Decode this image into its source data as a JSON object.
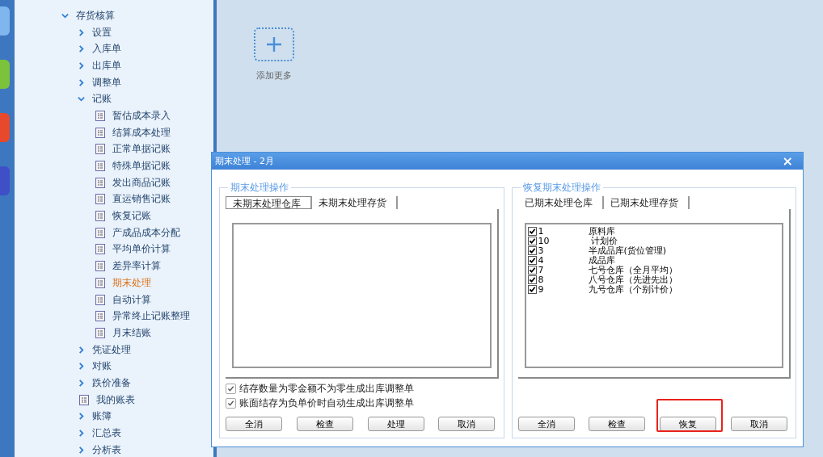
{
  "tree": [
    {
      "label": "存货核算",
      "kind": "folder",
      "expanded": true,
      "selected": false,
      "children": [
        {
          "label": "设置",
          "kind": "folder",
          "expanded": false,
          "selected": false
        },
        {
          "label": "入库单",
          "kind": "folder",
          "expanded": false,
          "selected": false
        },
        {
          "label": "出库单",
          "kind": "folder",
          "expanded": false,
          "selected": false
        },
        {
          "label": "调整单",
          "kind": "folder",
          "expanded": false,
          "selected": false
        },
        {
          "label": "记账",
          "kind": "folder",
          "expanded": true,
          "selected": false,
          "children": [
            {
              "label": "暂估成本录入",
              "kind": "doc",
              "selected": false
            },
            {
              "label": "结算成本处理",
              "kind": "doc",
              "selected": false
            },
            {
              "label": "正常单据记账",
              "kind": "doc",
              "selected": false
            },
            {
              "label": "特殊单据记账",
              "kind": "doc",
              "selected": false
            },
            {
              "label": "发出商品记账",
              "kind": "doc",
              "selected": false
            },
            {
              "label": "直运销售记账",
              "kind": "doc",
              "selected": false
            },
            {
              "label": "恢复记账",
              "kind": "doc",
              "selected": false
            },
            {
              "label": "产成品成本分配",
              "kind": "doc",
              "selected": false
            },
            {
              "label": "平均单价计算",
              "kind": "doc",
              "selected": false
            },
            {
              "label": "差异率计算",
              "kind": "doc",
              "selected": false
            },
            {
              "label": "期末处理",
              "kind": "doc",
              "selected": true
            },
            {
              "label": "自动计算",
              "kind": "doc",
              "selected": false
            },
            {
              "label": "异常终止记账整理",
              "kind": "doc",
              "selected": false
            },
            {
              "label": "月末结账",
              "kind": "doc",
              "selected": false
            }
          ]
        },
        {
          "label": "凭证处理",
          "kind": "folder",
          "expanded": false,
          "selected": false
        },
        {
          "label": "对账",
          "kind": "folder",
          "expanded": false,
          "selected": false
        },
        {
          "label": "跌价准备",
          "kind": "folder",
          "expanded": false,
          "selected": false
        },
        {
          "label": "我的账表",
          "kind": "doc",
          "selected": false
        },
        {
          "label": "账簿",
          "kind": "folder",
          "expanded": false,
          "selected": false
        },
        {
          "label": "汇总表",
          "kind": "folder",
          "expanded": false,
          "selected": false
        },
        {
          "label": "分析表",
          "kind": "folder",
          "expanded": false,
          "selected": false
        }
      ]
    }
  ],
  "add_tile": {
    "label": "添加更多"
  },
  "dialog": {
    "title": "期末处理 - 2月",
    "close": "×",
    "left": {
      "legend": "期末处理操作",
      "tabs": [
        {
          "label": "未期末处理仓库",
          "selected": true
        },
        {
          "label": "未期末处理存货",
          "selected": false
        }
      ],
      "options": [
        {
          "label": "结存数量为零金额不为零生成出库调整单",
          "checked": true
        },
        {
          "label": "账面结存为负单价时自动生成出库调整单",
          "checked": true
        }
      ],
      "buttons": [
        {
          "label": "全消",
          "highlighted": false
        },
        {
          "label": "检查",
          "highlighted": false
        },
        {
          "label": "处理",
          "highlighted": false
        },
        {
          "label": "取消",
          "highlighted": false
        }
      ]
    },
    "right": {
      "legend": "恢复期末处理操作",
      "tabs": [
        {
          "label": "已期末处理仓库"
        },
        {
          "label": "已期末处理存货"
        }
      ],
      "rows": [
        {
          "checked": true,
          "code": "1",
          "name": "原料库"
        },
        {
          "checked": true,
          "code": "10",
          "name": " 计划价"
        },
        {
          "checked": true,
          "code": "3",
          "name": "半成品库(货位管理)"
        },
        {
          "checked": true,
          "code": "4",
          "name": "成品库"
        },
        {
          "checked": true,
          "code": "7",
          "name": "七号仓库（全月平均）"
        },
        {
          "checked": true,
          "code": "8",
          "name": "八号仓库（先进先出）"
        },
        {
          "checked": true,
          "code": "9",
          "name": "九号仓库（个别计价）"
        }
      ],
      "buttons": [
        {
          "label": "全消",
          "highlighted": false
        },
        {
          "label": "检查",
          "highlighted": false
        },
        {
          "label": "恢复",
          "highlighted": true
        },
        {
          "label": "取消",
          "highlighted": false
        }
      ]
    }
  }
}
